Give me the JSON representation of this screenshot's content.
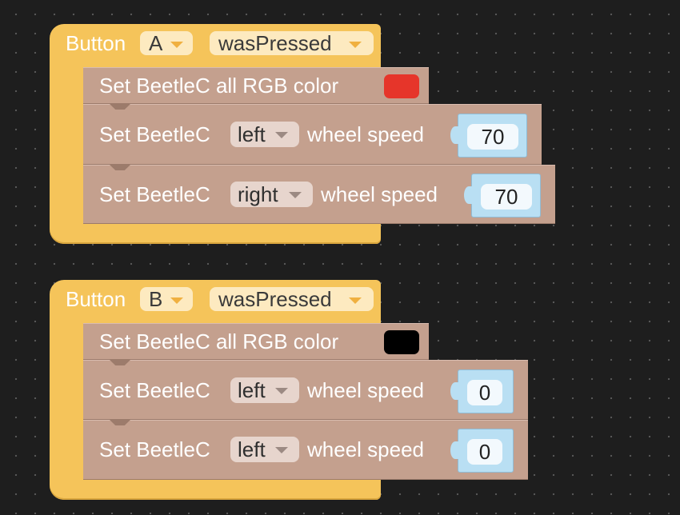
{
  "blocks": [
    {
      "hat": {
        "label": "Button",
        "button": "A",
        "event": "wasPressed"
      },
      "statements": [
        {
          "label": "Set BeetleC  all RGB color",
          "color": "#e6352a"
        },
        {
          "prefix": "Set BeetleC",
          "wheel": "left",
          "suffix": "wheel speed",
          "value": "70"
        },
        {
          "prefix": "Set BeetleC",
          "wheel": "right",
          "suffix": "wheel speed",
          "value": "70"
        }
      ]
    },
    {
      "hat": {
        "label": "Button",
        "button": "B",
        "event": "wasPressed"
      },
      "statements": [
        {
          "label": "Set BeetleC  all RGB color",
          "color": "#000000"
        },
        {
          "prefix": "Set BeetleC",
          "wheel": "left",
          "suffix": "wheel speed",
          "value": "0"
        },
        {
          "prefix": "Set BeetleC",
          "wheel": "left",
          "suffix": "wheel speed",
          "value": "0"
        }
      ]
    }
  ]
}
